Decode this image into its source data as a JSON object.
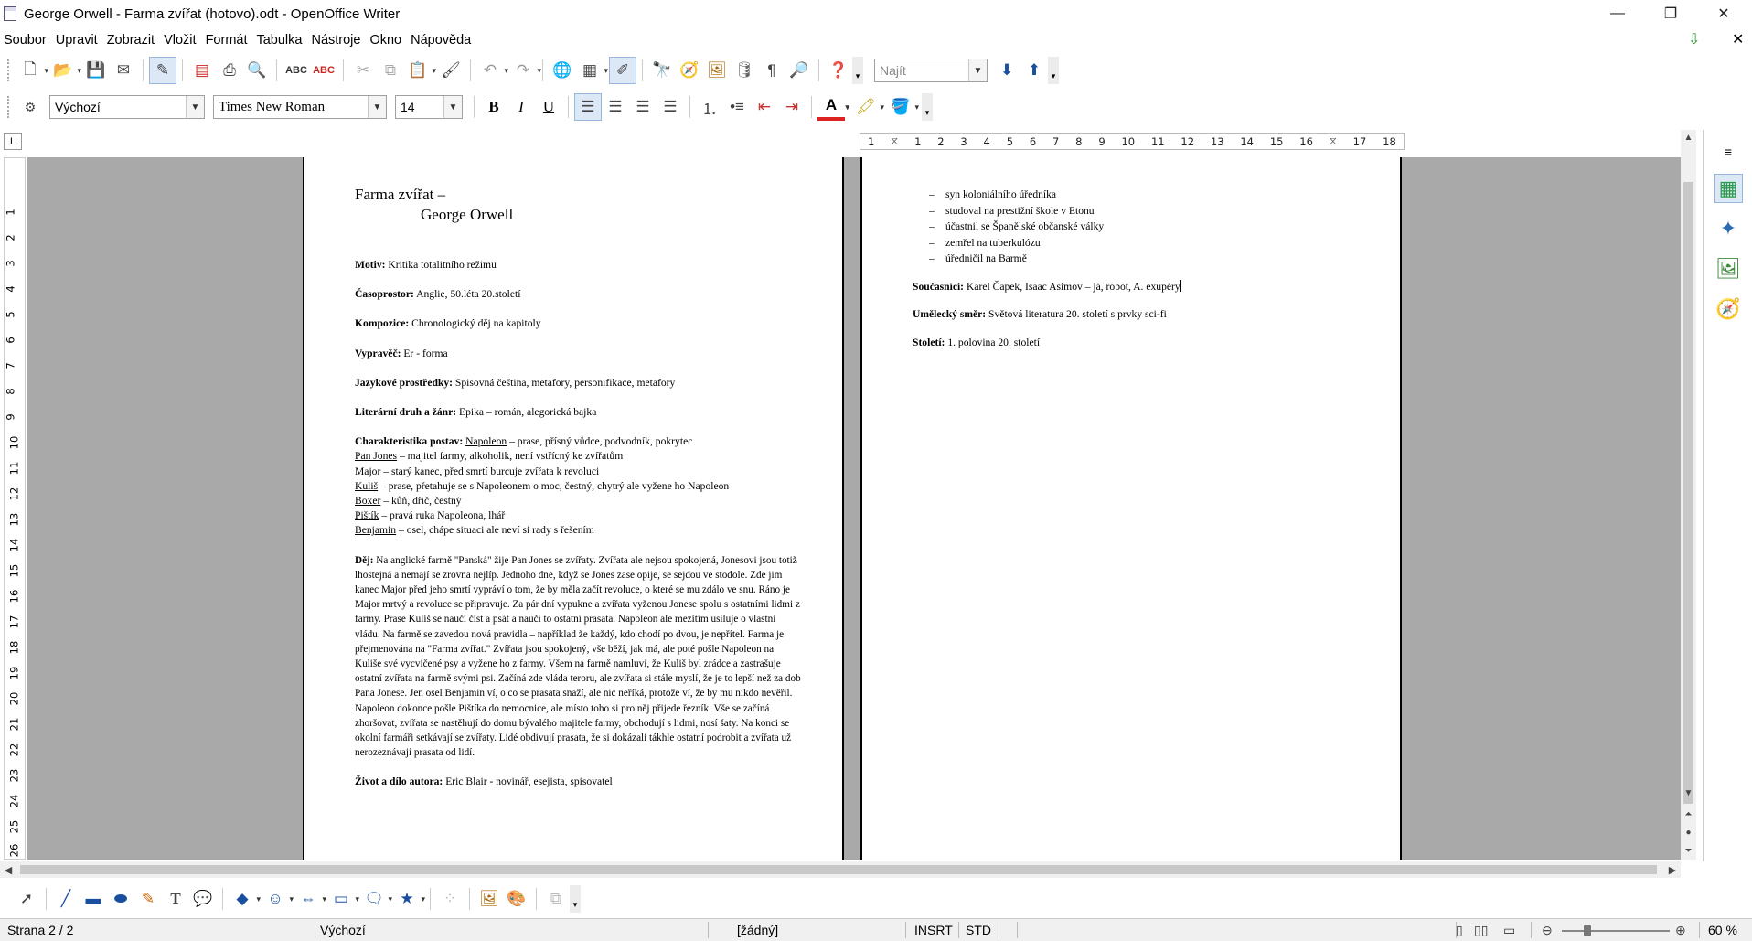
{
  "window": {
    "title": "George Orwell - Farma zvířat (hotovo).odt - OpenOffice Writer",
    "controls": {
      "minimize": "—",
      "restore": "❐",
      "close": "✕"
    }
  },
  "menu": {
    "items": [
      "Soubor",
      "Upravit",
      "Zobrazit",
      "Vložit",
      "Formát",
      "Tabulka",
      "Nástroje",
      "Okno",
      "Nápověda"
    ],
    "close_doc": "✕",
    "update_icon": "⇩"
  },
  "standard_toolbar": {
    "find_placeholder": "Najít"
  },
  "formatting_toolbar": {
    "paragraph_style": "Výchozí",
    "font_name": "Times New Roman",
    "font_size": "14",
    "bold": "B",
    "italic": "I",
    "underline": "U",
    "font_color_glyph": "A"
  },
  "ruler": {
    "corner": "L",
    "ticks": [
      "1",
      "1",
      "2",
      "3",
      "4",
      "5",
      "6",
      "7",
      "8",
      "9",
      "10",
      "11",
      "12",
      "13",
      "14",
      "15",
      "16",
      "17",
      "18"
    ],
    "vticks": [
      "1",
      "2",
      "3",
      "4",
      "5",
      "6",
      "7",
      "8",
      "9",
      "10",
      "11",
      "12",
      "13",
      "14",
      "15",
      "16",
      "17",
      "18",
      "19",
      "20",
      "21",
      "22",
      "23",
      "24",
      "25",
      "26"
    ]
  },
  "document": {
    "page1": {
      "title_line1": "Farma zvířat –",
      "title_line2": "George Orwell",
      "motiv_label": "Motiv:",
      "motiv_value": " Kritika totalitního režimu",
      "casoprostor_label": "Časoprostor:",
      "casoprostor_value": " Anglie, 50.léta 20.století",
      "kompozice_label": "Kompozice:",
      "kompozice_value": " Chronologický děj na kapitoly",
      "vypravec_label": "Vypravěč:",
      "vypravec_value": " Er - forma",
      "jazykove_label": "Jazykové prostředky:",
      "jazykove_value": " Spisovná čeština, metafory, personifikace, metafory",
      "druh_label": "Literární druh a žánr:",
      "druh_value": " Epika – román, alegorická bajka",
      "postavy_label": "Charakteristika postav:",
      "postavy": [
        {
          "name": "Napoleon",
          "desc": " – prase, přísný vůdce, podvodník, pokrytec"
        },
        {
          "name": "Pan Jones",
          "desc": " – majitel farmy, alkoholik, není vstřícný ke zvířatům"
        },
        {
          "name": "Major",
          "desc": " – starý kanec, před smrtí burcuje zvířata k revoluci"
        },
        {
          "name": "Kuliš",
          "desc": " – prase, přetahuje se s Napoleonem o moc, čestný, chytrý ale vyžene ho Napoleon"
        },
        {
          "name": "Boxer",
          "desc": " – kůň, dříč, čestný"
        },
        {
          "name": "Pištík",
          "desc": " – pravá ruka Napoleona, lhář"
        },
        {
          "name": "Benjamin",
          "desc": " – osel, chápe situaci ale neví si rady s řešením"
        }
      ],
      "dej_label": "Děj:",
      "dej_value": " Na anglické farmě \"Panská\" žije Pan Jones se zvířaty.  Zvířata ale nejsou spokojená, Jonesovi jsou totiž lhostejná a nemají se zrovna nejlíp. Jednoho dne, když se Jones zase opije, se sejdou ve stodole. Zde jim kanec Major před jeho smrtí vypráví o tom, že by měla začít revoluce, o které se mu zdálo ve snu. Ráno je Major mrtvý a revoluce se připravuje. Za pár dní vypukne a zvířata vyženou Jonese spolu s ostatními lidmi z farmy. Prase Kuliš se naučí číst a psát a naučí to ostatní prasata. Napoleon ale mezitím usiluje o vlastní vládu. Na farmě se zavedou nová pravidla – například že každý, kdo chodí po dvou, je nepřítel. Farma je přejmenována na \"Farma zvířat.\" Zvířata jsou spokojený, vše běží, jak má, ale poté pošle Napoleon na Kuliše své vycvičené psy a vyžene ho z farmy. Všem na farmě namluví, že Kuliš byl zrádce a zastrašuje ostatní zvířata na farmě svými psi. Začíná zde vláda teroru, ale zvířata si stále myslí, že je to lepší než za dob Pana Jonese. Jen osel Benjamin ví, o co se prasata snaží, ale nic neříká, protože ví, že by mu nikdo nevěřil. Napoleon dokonce pošle Pištíka do nemocnice, ale místo toho si pro něj přijede řezník. Vše se začíná zhoršovat, zvířata se nastěhují do domu bývalého majitele farmy, obchodují s lidmi, nosí šaty. Na konci se okolní farmáři setkávají se zvířaty. Lidé obdivují prasata, že si dokázali tákhle ostatní podrobit a zvířata už nerozeznávají prasata od lidí.",
      "zivot_label": "Život a dílo autora:",
      "zivot_value": "  Eric Blair - novinář, esejista, spisovatel"
    },
    "page2": {
      "bullets": [
        "syn koloniálního úředníka",
        "studoval na prestižní škole v Etonu",
        "účastnil se Španělské občanské války",
        "zemřel na tuberkulózu",
        "úředničil na Barmě"
      ],
      "soucasnici_label": "Současníci:",
      "soucasnici_value": " Karel Čapek, Isaac Asimov – já, robot, A. exupéry",
      "smer_label": "Umělecký směr:",
      "smer_value": " Světová literatura 20. století s prvky sci-fi",
      "stoleti_label": "Století:",
      "stoleti_value": " 1. polovina 20. století"
    }
  },
  "statusbar": {
    "page": "Strana 2 / 2",
    "style": "Výchozí",
    "language": "[žádný]",
    "insert_mode": "INSRT",
    "selection_mode": "STD",
    "zoom": "60 %"
  }
}
